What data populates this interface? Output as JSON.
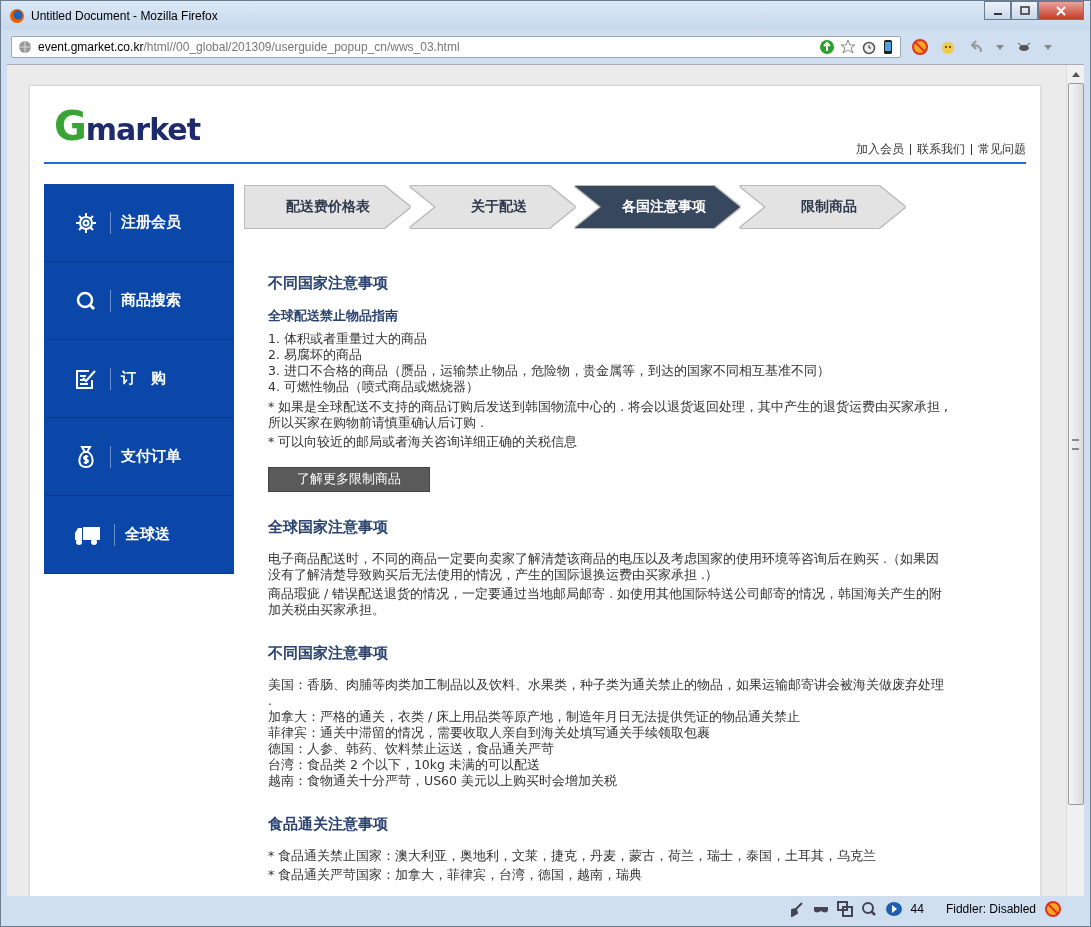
{
  "window": {
    "title": "Untitled Document - Mozilla Firefox",
    "address_host": "event.gmarket.co.kr",
    "address_path": "/html//00_global/201309/userguide_popup_cn/wws_03.html"
  },
  "logo": {
    "mark": "G",
    "word": "market"
  },
  "top_links": [
    "加入会员",
    "联系我们",
    "常见问题"
  ],
  "sidebar": {
    "items": [
      {
        "kind": "gear",
        "label": "注册会员"
      },
      {
        "kind": "search",
        "label": "商品搜索"
      },
      {
        "kind": "form",
        "label": "订　购"
      },
      {
        "kind": "bag",
        "label": "支付订单"
      },
      {
        "kind": "truck",
        "label": "全球送"
      }
    ]
  },
  "steps": [
    {
      "label": "配送费价格表",
      "selected": false
    },
    {
      "label": "关于配送",
      "selected": false
    },
    {
      "label": "各国注意事项",
      "selected": true
    },
    {
      "label": "限制商品",
      "selected": false
    }
  ],
  "sections": [
    {
      "heading": "不同国家注意事项",
      "subheading": "全球配送禁止物品指南",
      "lines": [
        "1. 体积或者重量过大的商品",
        "2. 易腐坏的商品",
        "3. 进口不合格的商品（赝品，运输禁止物品，危险物，贵金属等，到达的国家不同相互基准不同）",
        "4. 可燃性物品（喷式商品或燃烧器）"
      ],
      "paragraphs": [
        "* 如果是全球配送不支持的商品订购后发送到韩国物流中心的 . 将会以退货返回处理，其中产生的退货运费由买家承担 , 所以买家在购物前请慎重确认后订购 .",
        "* 可以向较近的邮局或者海关咨询详细正确的关税信息"
      ],
      "button": "了解更多限制商品"
    },
    {
      "heading": "全球国家注意事项",
      "paragraphs": [
        "电子商品配送时，不同的商品一定要向卖家了解清楚该商品的电压以及考虑国家的使用环境等咨询后在购买 .（如果因没有了解清楚导致购买后无法使用的情况，产生的国际退换运费由买家承担 .）",
        "商品瑕疵 / 错误配送退货的情况，一定要通过当地邮局邮寄 . 如使用其他国际特送公司邮寄的情况，韩国海关产生的附加关税由买家承担。"
      ]
    },
    {
      "heading": "不同国家注意事项",
      "lines": [
        "美国：香肠、肉脯等肉类加工制品以及饮料、水果类，种子类为通关禁止的物品，如果运输邮寄讲会被海关做废弃处理 .",
        "加拿大：严格的通关，衣类 / 床上用品类等原产地，制造年月日无法提供凭证的物品通关禁止",
        "菲律宾：通关中滞留的情况，需要收取人亲自到海关处填写通关手续领取包裹",
        "德国：人参、韩药、饮料禁止运送，食品通关严苛",
        "台湾：食品类 2 个以下，10kg 未满的可以配送",
        "越南：食物通关十分严苛，US60 美元以上购买时会增加关税"
      ]
    },
    {
      "heading": "食品通关注意事项",
      "paragraphs": [
        "* 食品通关禁止国家：澳大利亚，奥地利，文莱，捷克，丹麦，蒙古，荷兰，瑞士，泰国，土耳其，乌克兰",
        "* 食品通关严苛国家：加拿大，菲律宾，台湾，德国，越南，瑞典"
      ]
    }
  ],
  "status_bar": {
    "count": "44",
    "fiddler": "Fiddler: Disabled"
  }
}
